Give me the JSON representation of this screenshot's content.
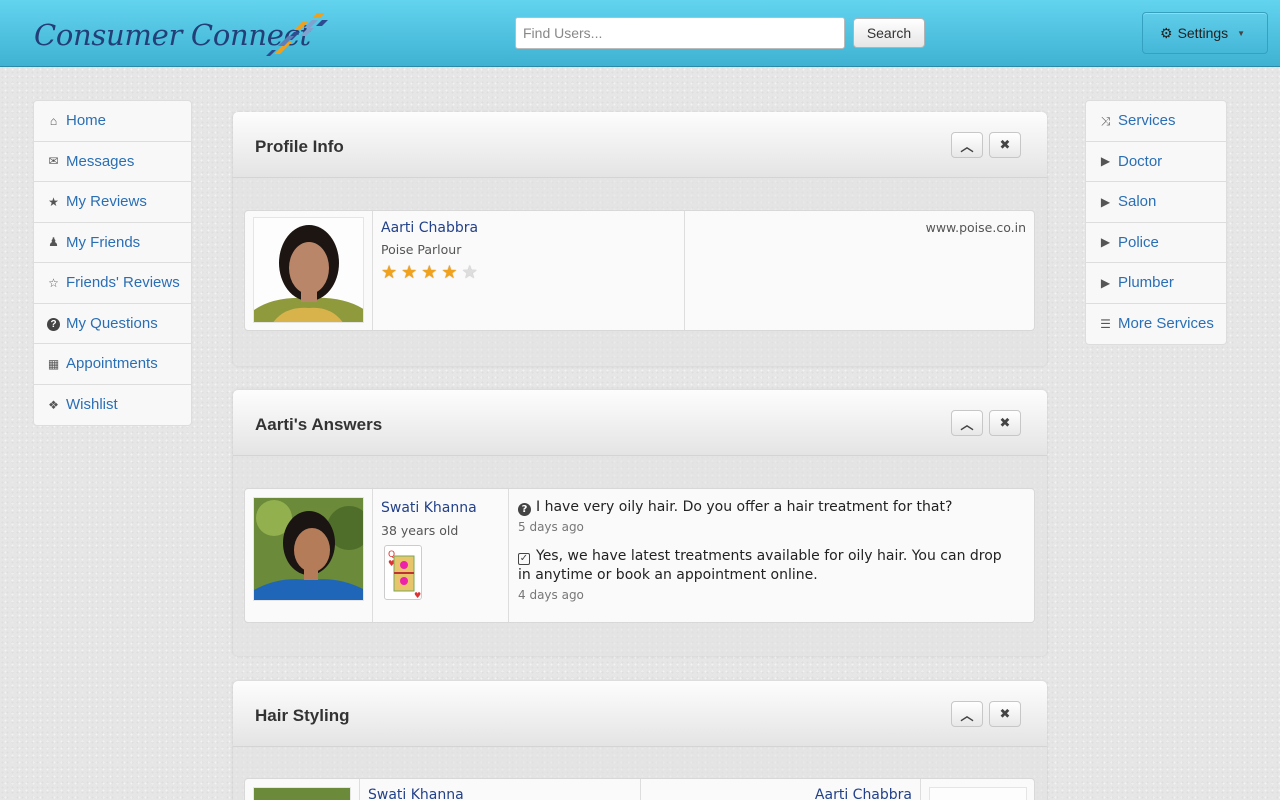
{
  "header": {
    "logo_text": "Consumer Connect",
    "search_placeholder": "Find Users...",
    "search_button": "Search",
    "settings_label": "Settings"
  },
  "left_nav": [
    {
      "label": "Home",
      "icon": "home-icon"
    },
    {
      "label": "Messages",
      "icon": "envelope-icon"
    },
    {
      "label": "My Reviews",
      "icon": "star-icon"
    },
    {
      "label": "My Friends",
      "icon": "user-icon"
    },
    {
      "label": "Friends' Reviews",
      "icon": "star-outline-icon"
    },
    {
      "label": "My Questions",
      "icon": "question-circle-icon"
    },
    {
      "label": "Appointments",
      "icon": "calendar-icon"
    },
    {
      "label": "Wishlist",
      "icon": "gift-icon"
    }
  ],
  "right_nav": [
    {
      "label": "Services",
      "icon": "shuffle-icon"
    },
    {
      "label": "Doctor",
      "icon": "play-icon"
    },
    {
      "label": "Salon",
      "icon": "play-icon"
    },
    {
      "label": "Police",
      "icon": "play-icon"
    },
    {
      "label": "Plumber",
      "icon": "play-icon"
    },
    {
      "label": "More Services",
      "icon": "list-icon"
    }
  ],
  "profile_panel": {
    "title": "Profile Info",
    "name": "Aarti Chabbra",
    "business": "Poise Parlour",
    "rating": 4,
    "rating_max": 5,
    "website": "www.poise.co.in"
  },
  "answers_panel": {
    "title": "Aarti's Answers",
    "user_name": "Swati Khanna",
    "user_age": "38 years old",
    "question": "I have very oily hair. Do you offer a hair treatment for that?",
    "question_time": "5 days ago",
    "answer": "Yes, we have latest treatments available for oily hair. You can drop in anytime or book an appointment online.",
    "answer_time": "4 days ago"
  },
  "styling_panel": {
    "title": "Hair Styling",
    "left_user": "Swati Khanna",
    "right_user": "Aarti Chabbra"
  },
  "colors": {
    "header": "#4cc3e3",
    "link": "#2a6fb5",
    "name": "#23418a",
    "star": "#f0a21c"
  }
}
